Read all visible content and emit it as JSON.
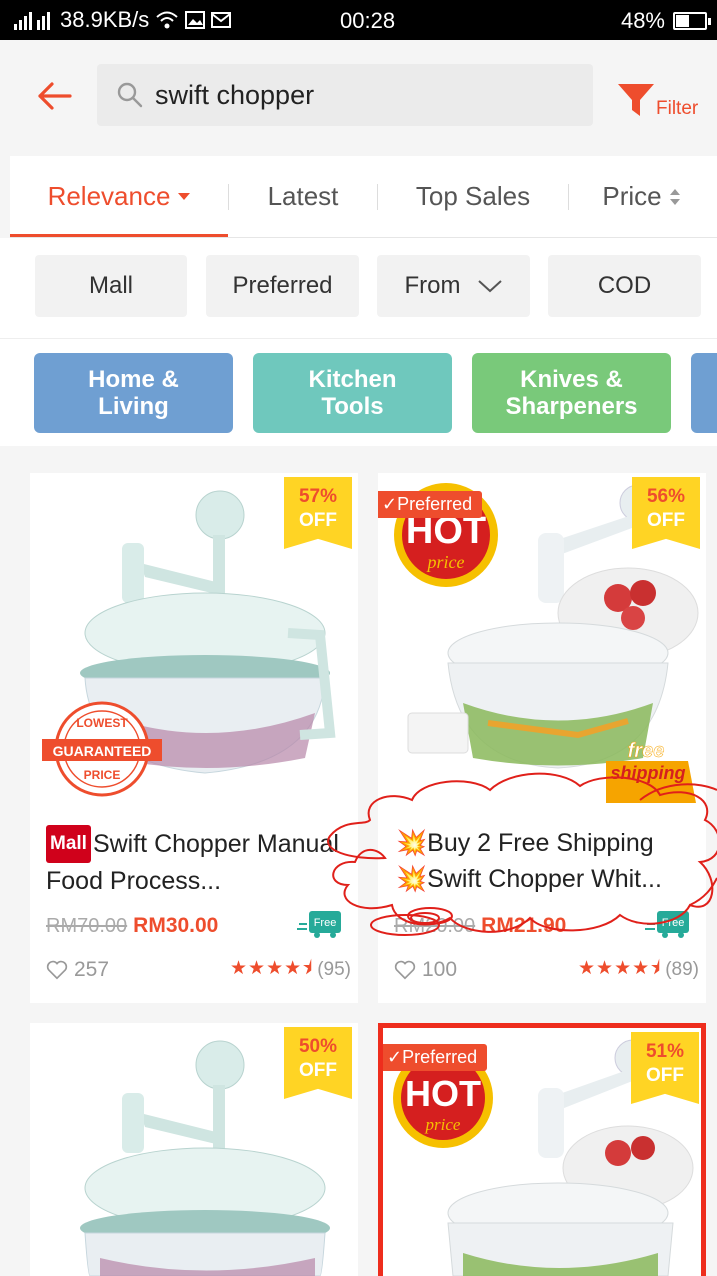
{
  "status_bar": {
    "network_speed": "38.9KB/s",
    "time": "00:28",
    "battery": "48%",
    "battery_level": 0.48
  },
  "search": {
    "query": "swift chopper",
    "filter_label": "Filter"
  },
  "sort_tabs": [
    {
      "label": "Relevance",
      "active": true
    },
    {
      "label": "Latest",
      "active": false
    },
    {
      "label": "Top Sales",
      "active": false
    },
    {
      "label": "Price",
      "active": false
    }
  ],
  "chips": [
    "Mall",
    "Preferred",
    "From",
    "COD"
  ],
  "categories": [
    {
      "label": "Home & Living",
      "color": "#6f9fd2"
    },
    {
      "label": "Kitchen Tools",
      "color": "#6fc8bd"
    },
    {
      "label": "Knives & Sharpeners",
      "color": "#79c97a"
    }
  ],
  "colors": {
    "accent": "#ee4d2d",
    "discount_bg": "#ffd424",
    "mall_badge": "#d0011b",
    "free_shipping": "#26aa99"
  },
  "products": [
    {
      "discount_pct": "57%",
      "discount_off": "OFF",
      "mall_badge": "Mall",
      "title": "Swift Chopper Manual Food Process...",
      "old_price": "RM70.00",
      "price": "RM30.00",
      "free_label": "Free",
      "likes": "257",
      "rating": 4.5,
      "rating_count": "(95)",
      "badge_text": "GUARANTEED",
      "badge_top": "LOWEST",
      "badge_bottom": "PRICE"
    },
    {
      "discount_pct": "56%",
      "discount_off": "OFF",
      "preferred": "Preferred",
      "hot": "HOT",
      "hot_sub": "price",
      "title": "Buy 2 Free Shipping Swift Chopper Whit...",
      "title_line1": "Buy 2 Free Shipping",
      "title_line2": "Swift Chopper Whit...",
      "old_price": "RM20.00",
      "price": "RM21.90",
      "free_label": "Free",
      "likes": "100",
      "rating": 4.5,
      "rating_count": "(89)",
      "free_ship_top": "free",
      "free_ship_bottom": "shipping"
    },
    {
      "discount_pct": "50%",
      "discount_off": "OFF"
    },
    {
      "discount_pct": "51%",
      "discount_off": "OFF",
      "preferred": "Preferred",
      "hot": "HOT",
      "hot_sub": "price"
    }
  ]
}
